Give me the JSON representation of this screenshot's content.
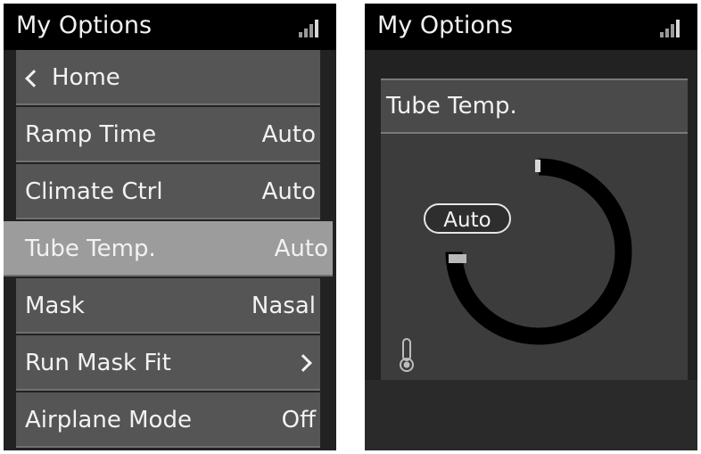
{
  "left_screen": {
    "title": "My Options",
    "menu": [
      {
        "label": "Home",
        "value": "",
        "icon": "chevron-left-icon"
      },
      {
        "label": "Ramp Time",
        "value": "Auto"
      },
      {
        "label": "Climate Ctrl",
        "value": "Auto"
      },
      {
        "label": "Tube Temp.",
        "value": "Auto",
        "selected": true
      },
      {
        "label": "Mask",
        "value": "Nasal"
      },
      {
        "label": "Run Mask Fit",
        "value": "",
        "icon": "chevron-right-icon"
      },
      {
        "label": "Airplane Mode",
        "value": "Off"
      }
    ]
  },
  "right_screen": {
    "title": "My Options",
    "panel_title": "Tube Temp.",
    "setting_value": "Auto",
    "icons": [
      "signal-icon",
      "thermometer-icon"
    ]
  },
  "colors": {
    "header_bg": "#000000",
    "row_bg": "#555555",
    "row_selected_bg": "#9c9c9c",
    "dial_ring": "#000000",
    "text": "#f2f2f2"
  }
}
